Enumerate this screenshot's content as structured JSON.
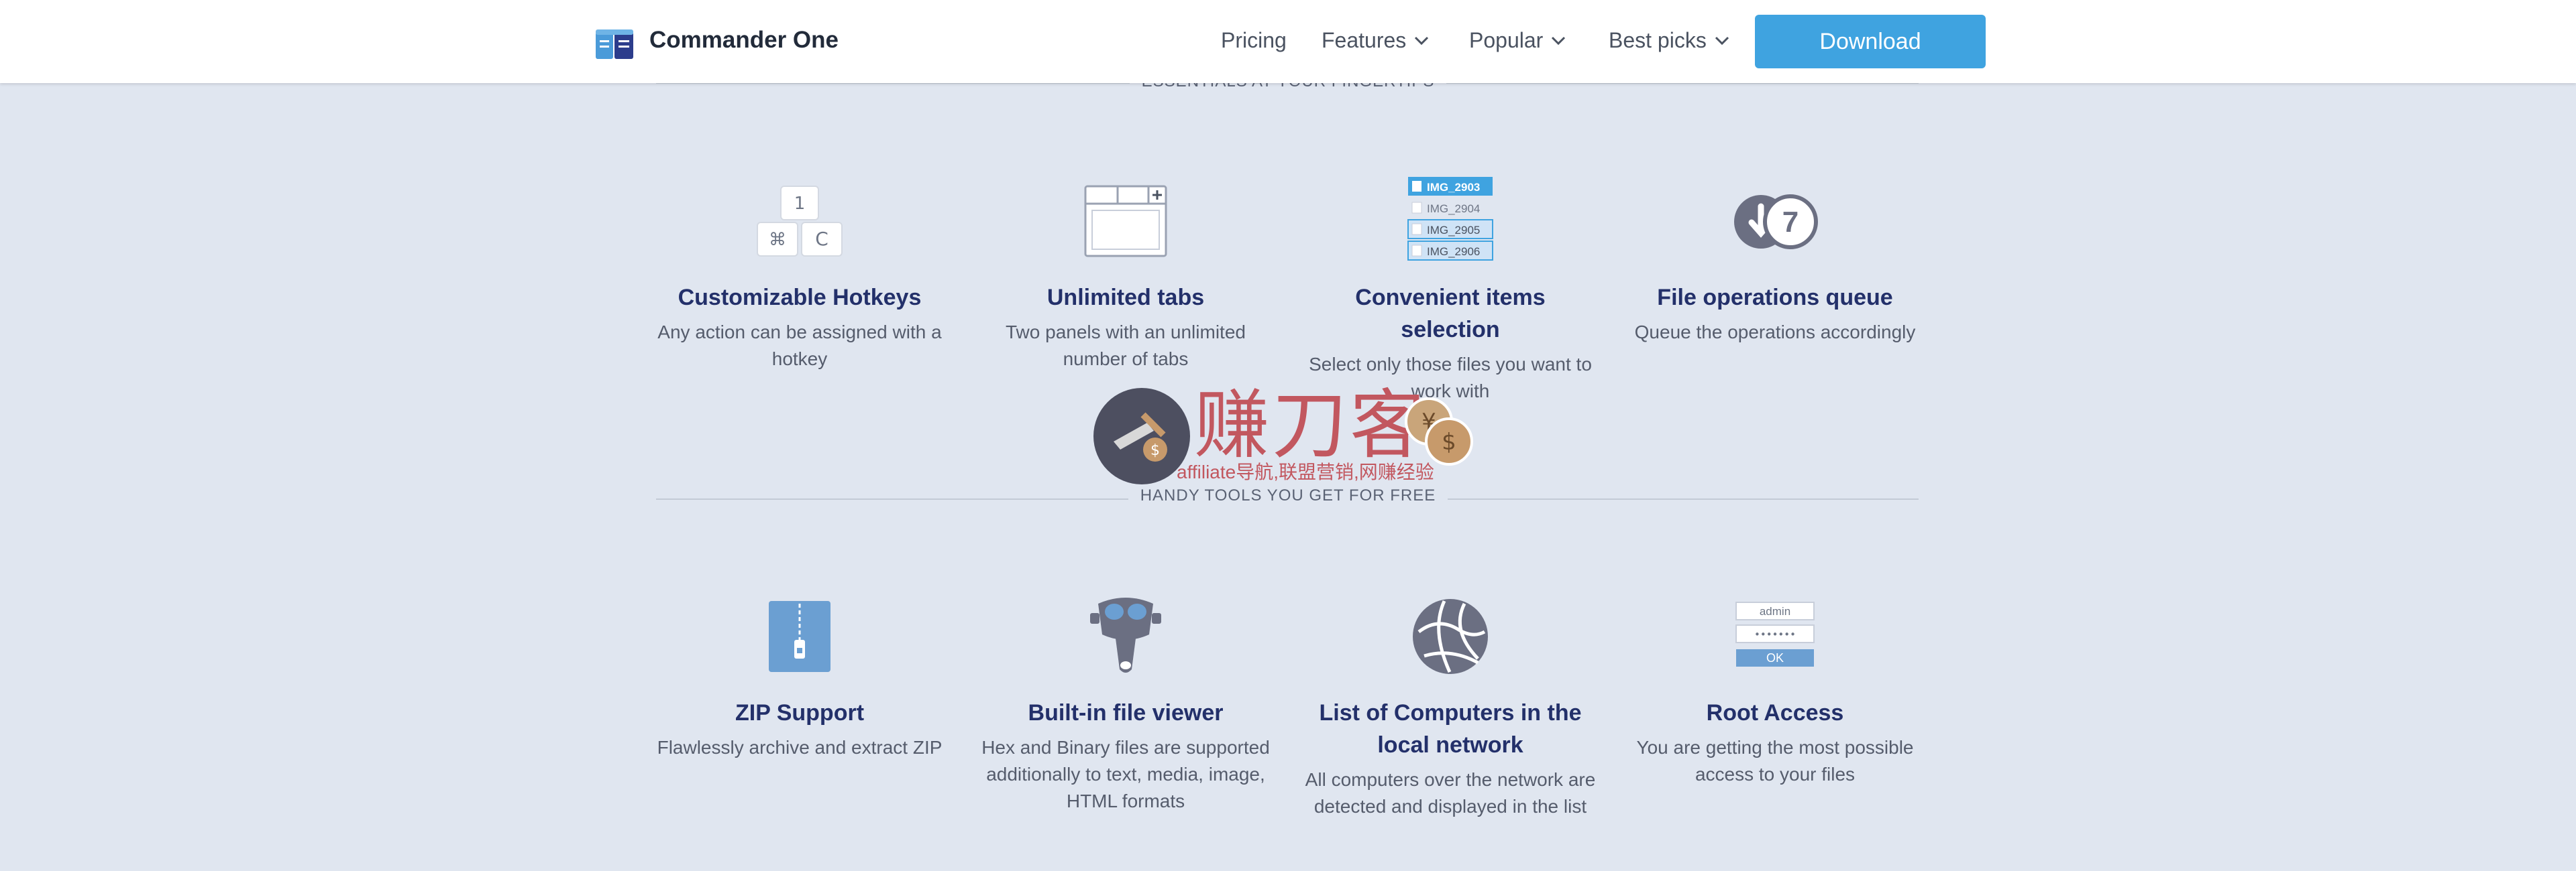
{
  "header": {
    "brand": "Commander One",
    "nav": [
      {
        "label": "Pricing"
      },
      {
        "label": "Features"
      },
      {
        "label": "Popular"
      },
      {
        "label": "Best picks"
      }
    ],
    "download_label": "Download"
  },
  "sections": {
    "top_label": "ESSENTIALS AT YOUR FINGERTIPS",
    "tools_label": "HANDY TOOLS YOU GET FOR FREE"
  },
  "features": [
    {
      "title": "Customizable Hotkeys",
      "desc": "Any action can be assigned with a hotkey",
      "keys": [
        "1",
        "⌘",
        "C"
      ]
    },
    {
      "title": "Unlimited tabs",
      "desc": "Two panels with an unlimited number of tabs"
    },
    {
      "title": "Convenient items selection",
      "desc": "Select only those files you want to work with",
      "files": [
        "IMG_2903",
        "IMG_2904",
        "IMG_2905",
        "IMG_2906"
      ]
    },
    {
      "title": "File operations queue",
      "desc": "Queue the operations accordingly",
      "queue_number": "7"
    }
  ],
  "tools": [
    {
      "title": "ZIP Support",
      "desc": "Flawlessly archive and extract ZIP"
    },
    {
      "title": "Built-in file viewer",
      "desc": "Hex and Binary files are supported additionally to text, media, image, HTML formats"
    },
    {
      "title": "List of Computers in the local network",
      "desc": "All computers over the network are detected and displayed in the list"
    },
    {
      "title": "Root Access",
      "desc": "You are getting the most possible access to your files",
      "login_user": "admin",
      "login_pass": "•••••••",
      "ok_label": "OK"
    }
  ],
  "watermark": {
    "main": "赚刀客",
    "sub": "affiliate导航,联盟营销,网赚经验"
  },
  "colors": {
    "accent": "#3fa3e0",
    "title": "#23306a",
    "background": "#e0e6f0"
  }
}
